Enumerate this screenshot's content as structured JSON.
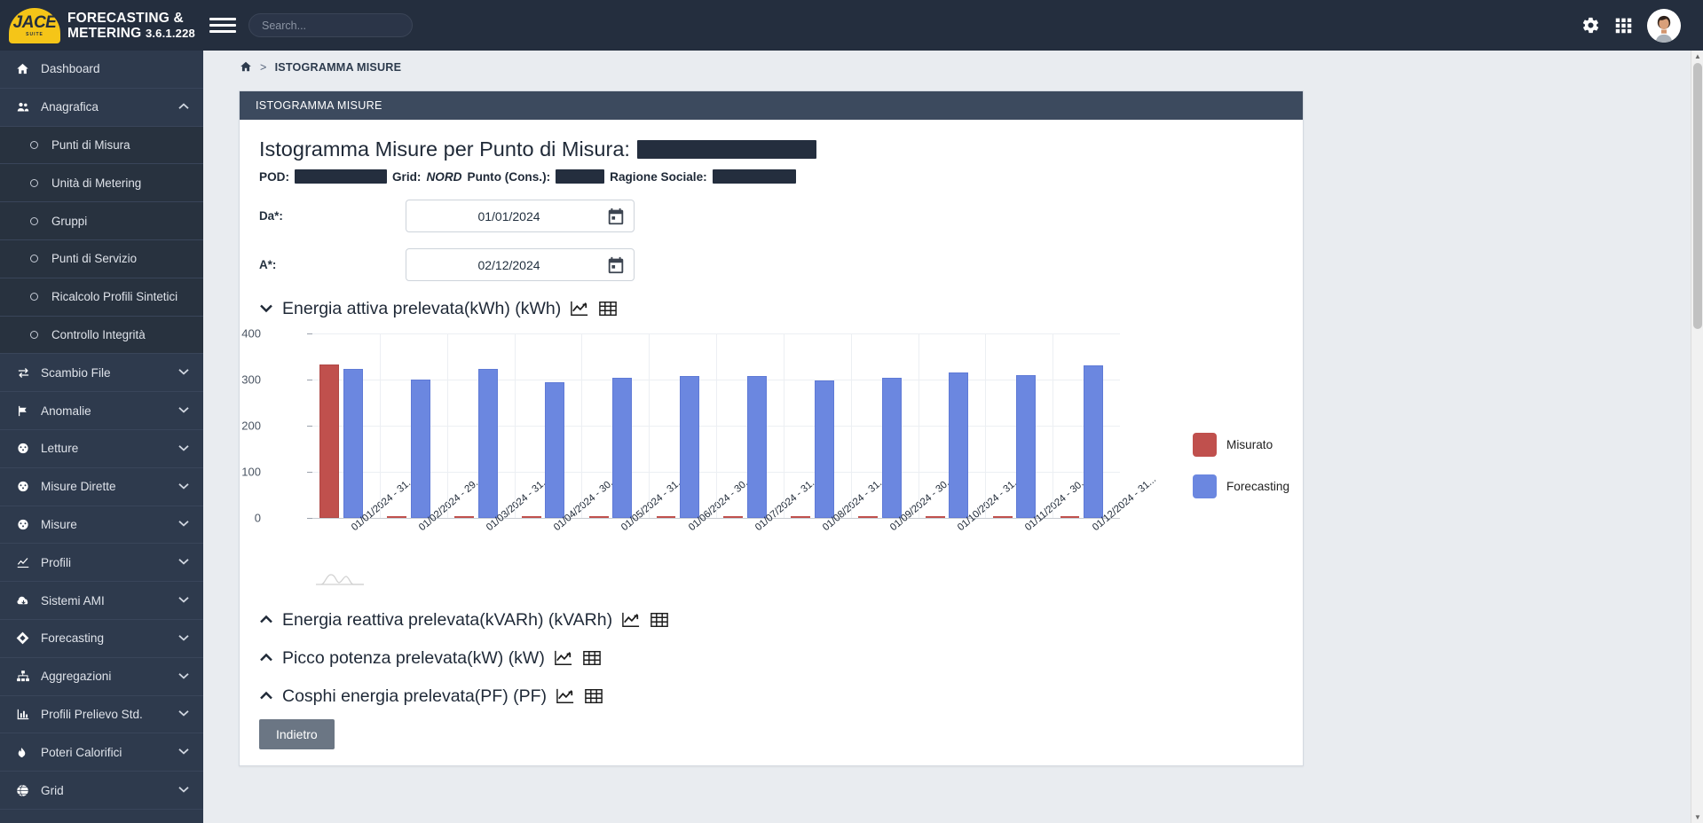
{
  "app": {
    "logo_mark": "JACE",
    "logo_mark_sub": "SUITE",
    "brand_line1": "FORECASTING &",
    "brand_line2": "METERING",
    "version": "3.6.1.228",
    "search_placeholder": "Search..."
  },
  "sidebar": {
    "items": [
      {
        "label": "Dashboard",
        "icon": "home-icon",
        "level": 0,
        "chevron": ""
      },
      {
        "label": "Anagrafica",
        "icon": "users-icon",
        "level": 0,
        "chevron": "up"
      },
      {
        "label": "Punti di Misura",
        "icon": "circle-icon",
        "level": 1,
        "chevron": ""
      },
      {
        "label": "Unità di Metering",
        "icon": "circle-icon",
        "level": 1,
        "chevron": ""
      },
      {
        "label": "Gruppi",
        "icon": "circle-icon",
        "level": 1,
        "chevron": ""
      },
      {
        "label": "Punti di Servizio",
        "icon": "circle-icon",
        "level": 1,
        "chevron": ""
      },
      {
        "label": "Ricalcolo Profili Sintetici",
        "icon": "circle-icon",
        "level": 1,
        "chevron": ""
      },
      {
        "label": "Controllo Integrità",
        "icon": "circle-icon",
        "level": 1,
        "chevron": ""
      },
      {
        "label": "Scambio File",
        "icon": "exchange-icon",
        "level": 0,
        "chevron": "down"
      },
      {
        "label": "Anomalie",
        "icon": "flag-icon",
        "level": 0,
        "chevron": "down"
      },
      {
        "label": "Letture",
        "icon": "gauge-icon",
        "level": 0,
        "chevron": "down"
      },
      {
        "label": "Misure Dirette",
        "icon": "gauge-icon",
        "level": 0,
        "chevron": "down"
      },
      {
        "label": "Misure",
        "icon": "gauge-icon",
        "level": 0,
        "chevron": "down"
      },
      {
        "label": "Profili",
        "icon": "line-chart-icon",
        "level": 0,
        "chevron": "down"
      },
      {
        "label": "Sistemi AMI",
        "icon": "cloud-icon",
        "level": 0,
        "chevron": "down"
      },
      {
        "label": "Forecasting",
        "icon": "diamond-icon",
        "level": 0,
        "chevron": "down"
      },
      {
        "label": "Aggregazioni",
        "icon": "sitemap-icon",
        "level": 0,
        "chevron": "down"
      },
      {
        "label": "Profili Prelievo Std.",
        "icon": "bar-chart-icon",
        "level": 0,
        "chevron": "down"
      },
      {
        "label": "Poteri Calorifici",
        "icon": "flame-icon",
        "level": 0,
        "chevron": "down"
      },
      {
        "label": "Grid",
        "icon": "globe-icon",
        "level": 0,
        "chevron": "down"
      }
    ]
  },
  "breadcrumb": {
    "home_icon": "home-icon",
    "separator": ">",
    "current": "ISTOGRAMMA MISURE"
  },
  "card": {
    "header": "ISTOGRAMMA MISURE",
    "title": "Istogramma Misure per Punto di Misura:",
    "title_redacted_width": 202,
    "meta": {
      "pod_label": "POD:",
      "pod_redacted_width": 104,
      "grid_label": "Grid:",
      "grid_value": "NORD",
      "punto_label": "Punto (Cons.):",
      "punto_redacted_width": 55,
      "ragione_label": "Ragione Sociale:",
      "ragione_redacted_width": 94
    },
    "fields": [
      {
        "label": "Da*:",
        "value": "01/01/2024",
        "icon": "calendar-icon"
      },
      {
        "label": "A*:",
        "value": "02/12/2024",
        "icon": "calendar-icon"
      }
    ],
    "sections": [
      {
        "label": "Energia attiva prelevata(kWh) (kWh)",
        "expanded": true,
        "chevron": "down",
        "chart_icon": "line-chart-icon",
        "table_icon": "table-icon"
      },
      {
        "label": "Energia reattiva prelevata(kVARh) (kVARh)",
        "expanded": false,
        "chevron": "up",
        "chart_icon": "line-chart-icon",
        "table_icon": "table-icon"
      },
      {
        "label": "Picco potenza prelevata(kW) (kW)",
        "expanded": false,
        "chevron": "up",
        "chart_icon": "line-chart-icon",
        "table_icon": "table-icon"
      },
      {
        "label": "Cosphi energia prelevata(PF) (PF)",
        "expanded": false,
        "chevron": "up",
        "chart_icon": "line-chart-icon",
        "table_icon": "table-icon"
      }
    ],
    "back_button": "Indietro"
  },
  "chart_data": {
    "type": "bar",
    "title": "Energia attiva prelevata(kWh) (kWh)",
    "xlabel": "",
    "ylabel": "",
    "ylim": [
      0,
      400
    ],
    "yticks": [
      0,
      100,
      200,
      300,
      400
    ],
    "grid": true,
    "legend_position": "right",
    "categories": [
      "01/01/2024 - 31...",
      "01/02/2024 - 29...",
      "01/03/2024 - 31...",
      "01/04/2024 - 30...",
      "01/05/2024 - 31...",
      "01/06/2024 - 30...",
      "01/07/2024 - 31...",
      "01/08/2024 - 31...",
      "01/09/2024 - 30...",
      "01/10/2024 - 31...",
      "01/11/2024 - 30...",
      "01/12/2024 - 31..."
    ],
    "series": [
      {
        "name": "Misurato",
        "color": "#c0504d",
        "values": [
          332,
          0,
          0,
          0,
          0,
          0,
          0,
          0,
          0,
          0,
          0,
          0
        ]
      },
      {
        "name": "Forecasting",
        "color": "#6b87e0",
        "values": [
          324,
          300,
          324,
          295,
          303,
          307,
          308,
          298,
          303,
          316,
          310,
          331
        ]
      }
    ]
  },
  "topbar_icons": {
    "gear": "gear-icon",
    "grid": "grid-apps-icon",
    "avatar": "avatar"
  }
}
